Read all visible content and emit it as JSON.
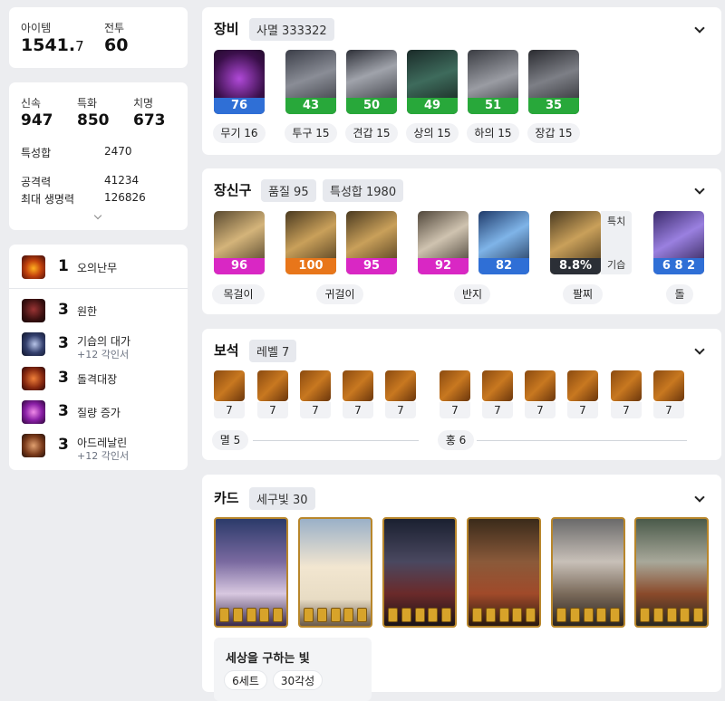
{
  "summary": {
    "item_label": "아이템",
    "item_value": "1541.",
    "item_decimal": "7",
    "combat_label": "전투",
    "combat_value": "60"
  },
  "stats": {
    "swift_label": "신속",
    "swift_value": "947",
    "spec_label": "특화",
    "spec_value": "850",
    "crit_label": "치명",
    "crit_value": "673",
    "total_label": "특성합",
    "total_value": "2470",
    "atk_label": "공격력",
    "atk_value": "41234",
    "hp_label": "최대 생명력",
    "hp_value": "126826"
  },
  "engravings": [
    {
      "level": "1",
      "name": "오의난무",
      "sub": "",
      "icon": "fire-burst-icon"
    },
    {
      "level": "3",
      "name": "원한",
      "sub": "",
      "icon": "skull-icon"
    },
    {
      "level": "3",
      "name": "기습의 대가",
      "sub": "+12 각인서",
      "icon": "moon-icon"
    },
    {
      "level": "3",
      "name": "돌격대장",
      "sub": "",
      "icon": "charge-icon"
    },
    {
      "level": "3",
      "name": "질량 증가",
      "sub": "",
      "icon": "crystal-icon"
    },
    {
      "level": "3",
      "name": "아드레날린",
      "sub": "+12 각인서",
      "icon": "adrenaline-icon"
    }
  ],
  "equipment": {
    "title": "장비",
    "badge": "사멸 333322",
    "items": [
      {
        "slot": "무기 16",
        "quality": "76",
        "color": "#2f6fd6"
      },
      {
        "slot": "투구 15",
        "quality": "43",
        "color": "#28a83a"
      },
      {
        "slot": "견갑 15",
        "quality": "50",
        "color": "#28a83a"
      },
      {
        "slot": "상의 15",
        "quality": "49",
        "color": "#28a83a"
      },
      {
        "slot": "하의 15",
        "quality": "51",
        "color": "#28a83a"
      },
      {
        "slot": "장갑 15",
        "quality": "35",
        "color": "#28a83a"
      }
    ]
  },
  "accessories": {
    "title": "장신구",
    "badge1": "품질 95",
    "badge2": "특성합 1980",
    "items": [
      {
        "quality": "96",
        "color": "#d927c4"
      },
      {
        "quality": "100",
        "color": "#e8761a"
      },
      {
        "quality": "95",
        "color": "#d927c4"
      },
      {
        "quality": "92",
        "color": "#d927c4"
      },
      {
        "quality": "82",
        "color": "#2f6fd6"
      },
      {
        "quality": "8.8%",
        "color": "#2b2f36"
      },
      {
        "quality": "6 8 2",
        "color": "#2f6fd6"
      }
    ],
    "bracelet_tags": [
      "특치",
      "기습"
    ],
    "captions": [
      "목걸이",
      "귀걸이",
      "반지",
      "팔찌",
      "돌"
    ]
  },
  "gems": {
    "title": "보석",
    "badge": "레벨 7",
    "levels_left": [
      "7",
      "7",
      "7",
      "7",
      "7"
    ],
    "levels_right": [
      "7",
      "7",
      "7",
      "7",
      "7",
      "7"
    ],
    "group_left": "멸 5",
    "group_right": "홍 6"
  },
  "cards": {
    "title": "카드",
    "badge": "세구빛 30",
    "set_name": "세상을 구하는 빛",
    "set_count": "6세트",
    "set_awaken": "30각성"
  }
}
